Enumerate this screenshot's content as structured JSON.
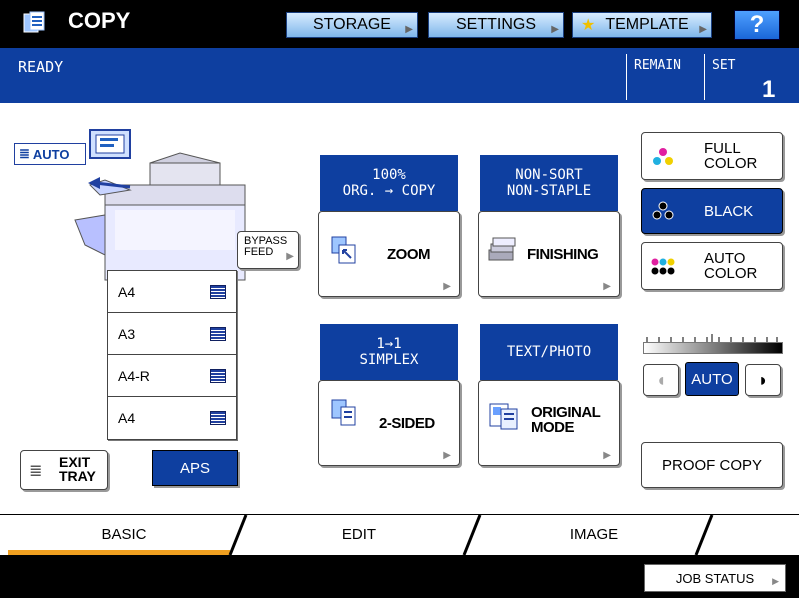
{
  "header": {
    "title": "COPY",
    "storage_label": "STORAGE",
    "settings_label": "SETTINGS",
    "template_label": "TEMPLATE",
    "help_label": "?"
  },
  "status": {
    "state": "READY",
    "remain_label": "REMAIN",
    "set_label": "SET",
    "set_value": "1"
  },
  "machine": {
    "auto_label": "AUTO",
    "bypass_label_1": "BYPASS",
    "bypass_label_2": "FEED",
    "trays": [
      {
        "label": "A4"
      },
      {
        "label": "A3"
      },
      {
        "label": "A4-R"
      },
      {
        "label": "A4"
      }
    ],
    "exit_tray_1": "EXIT",
    "exit_tray_2": "TRAY",
    "aps_label": "APS"
  },
  "functions": {
    "zoom": {
      "status_1": "100%",
      "status_2": "ORG. → COPY",
      "label": "ZOOM"
    },
    "finishing": {
      "status_1": "NON-SORT",
      "status_2": "NON-STAPLE",
      "label": "FINISHING"
    },
    "sided": {
      "status_1": "1→1",
      "status_2": "SIMPLEX",
      "label": "2-SIDED"
    },
    "original": {
      "status_1": "TEXT/PHOTO",
      "label_1": "ORIGINAL",
      "label_2": "MODE"
    }
  },
  "color": {
    "full_1": "FULL",
    "full_2": "COLOR",
    "black": "BLACK",
    "auto_1": "AUTO",
    "auto_2": "COLOR"
  },
  "density": {
    "auto_label": "AUTO",
    "level": 0.5
  },
  "proof_copy_label": "PROOF COPY",
  "tabs": [
    {
      "label": "BASIC"
    },
    {
      "label": "EDIT"
    },
    {
      "label": "IMAGE"
    }
  ],
  "job_status_label": "JOB STATUS",
  "colors": {
    "accent_blue": "#0e3fa0",
    "tab_underline": "#f0a020"
  }
}
